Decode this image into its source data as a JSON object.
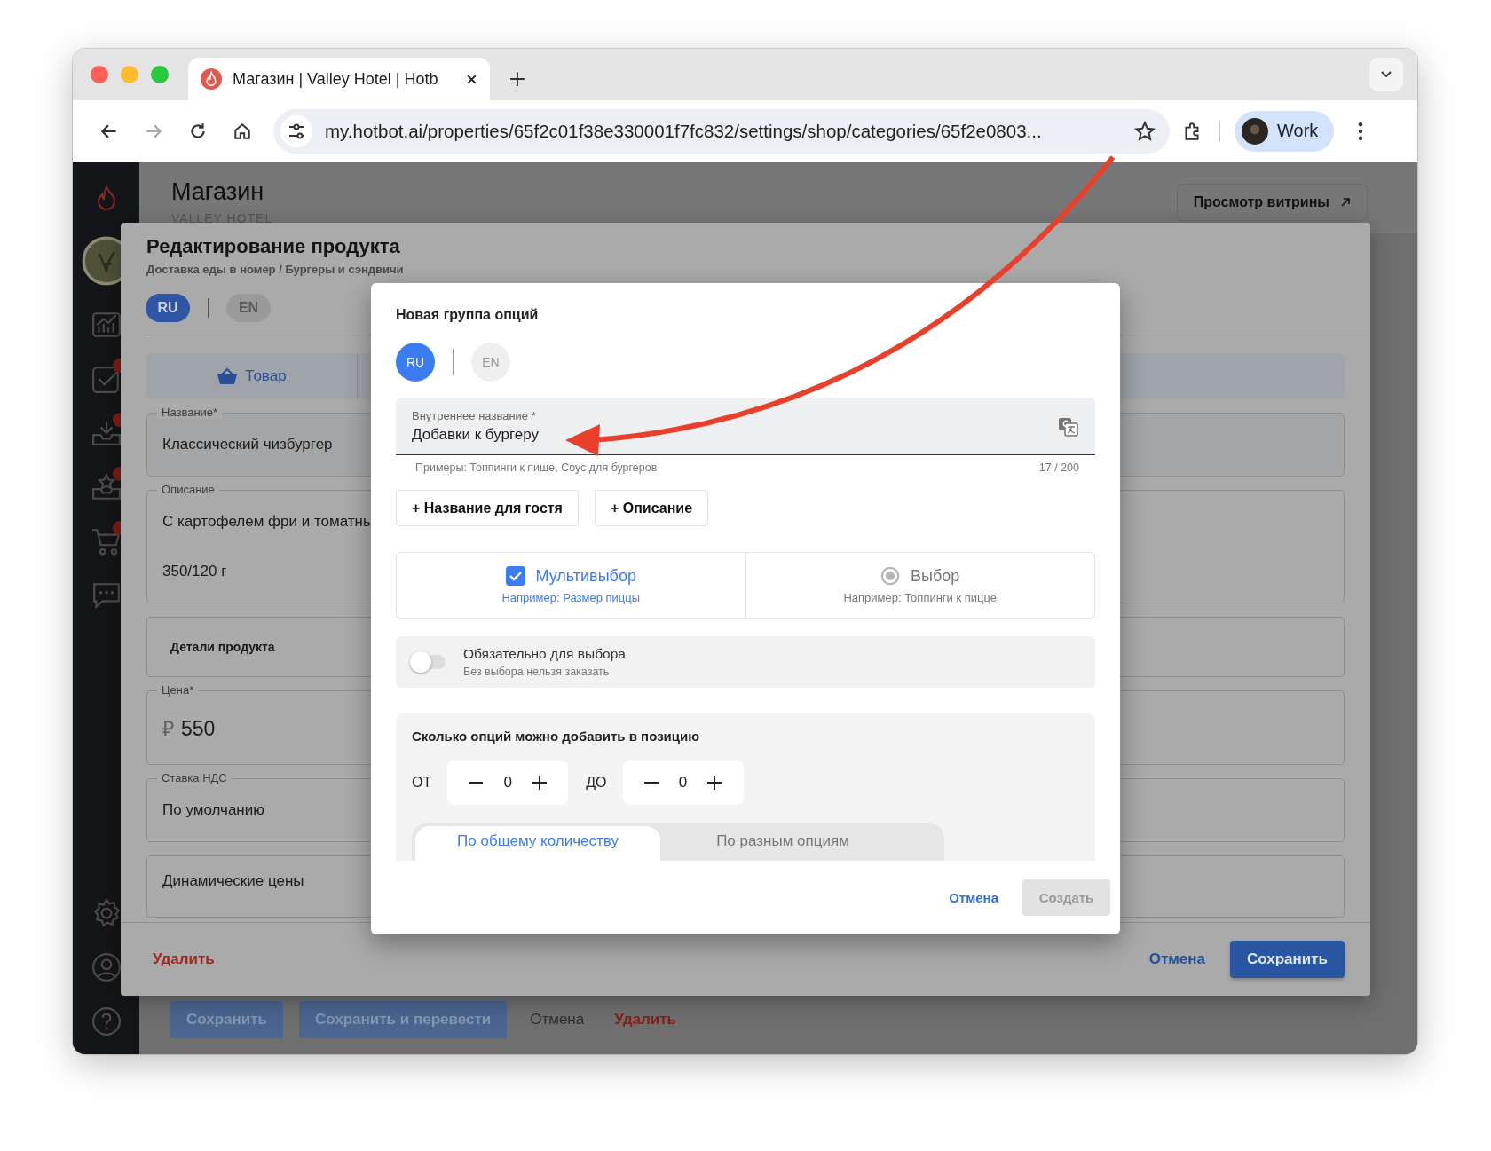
{
  "browser": {
    "tab_title": "Магазин | Valley Hotel | Hotb",
    "url": "my.hotbot.ai/properties/65f2c01f38e330001f7fc832/settings/shop/categories/65f2e0803...",
    "profile": "Work"
  },
  "page": {
    "title": "Магазин",
    "subtitle": "VALLEY HOTEL",
    "storefront_button": "Просмотр витрины",
    "footer_buttons": [
      {
        "label": "Сохранить",
        "kind": "primary"
      },
      {
        "label": "Сохранить и перевести",
        "kind": "primary"
      },
      {
        "label": "Отмена",
        "kind": "link"
      },
      {
        "label": "Удалить",
        "kind": "danger"
      }
    ]
  },
  "product_modal": {
    "title": "Редактирование продукта",
    "breadcrumb": "Доставка еды в номер / Бургеры и сэндвичи",
    "languages": [
      {
        "label": "RU",
        "selected": true
      },
      {
        "label": "EN",
        "selected": false
      }
    ],
    "tab": {
      "label": "Товар"
    },
    "fields": [
      {
        "kind": "field",
        "label": "Название*",
        "lines": [
          "Классический чизбургер"
        ]
      },
      {
        "kind": "field",
        "label": "Описание",
        "lines": [
          "С картофелем фри и томатны",
          "350/120 г"
        ]
      },
      {
        "kind": "section",
        "label": "Детали продукта"
      },
      {
        "kind": "price",
        "label": "Цена*",
        "currency": "₽",
        "lines": [
          "550"
        ]
      },
      {
        "kind": "field",
        "label": "Ставка НДС",
        "lines": [
          "По умолчанию"
        ]
      },
      {
        "kind": "plain",
        "label": "Динамические цены"
      }
    ],
    "delete": "Удалить",
    "cancel": "Отмена",
    "save": "Сохранить"
  },
  "dialog": {
    "title": "Новая группа опций",
    "languages": [
      {
        "label": "RU",
        "selected": true
      },
      {
        "label": "EN",
        "selected": false
      }
    ],
    "name_field": {
      "label": "Внутреннее название *",
      "value": "Добавки к бургеру",
      "hint": "Примеры: Топпинги к пище, Соус для бургеров",
      "counter": "17 / 200"
    },
    "add_buttons": [
      "+ Название для гостя",
      "+ Описание"
    ],
    "modes": [
      {
        "kind": "checkbox",
        "label": "Мультивыбор",
        "hint": "Например: Размер пиццы",
        "selected": true
      },
      {
        "kind": "radio",
        "label": "Выбор",
        "hint": "Например: Топпинги к пицце",
        "selected": false
      }
    ],
    "required": {
      "label": "Обязательно для выбора",
      "hint": "Без выбора нельзя заказать",
      "on": false
    },
    "quantity": {
      "title": "Сколько опций можно добавить в позицию",
      "steppers": [
        {
          "label": "ОТ",
          "value": "0"
        },
        {
          "label": "ДО",
          "value": "0"
        }
      ],
      "tabs": [
        {
          "label": "По общему количеству",
          "selected": true
        },
        {
          "label": "По разным опциям",
          "selected": false
        }
      ]
    },
    "cancel": "Отмена",
    "create": {
      "label": "Создать",
      "disabled": true
    }
  }
}
